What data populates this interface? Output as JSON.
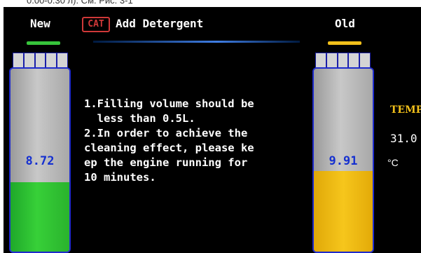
{
  "caption": "0.00-0.30 л). См. Рис. 3-1",
  "header": {
    "new_label": "New",
    "old_label": "Old",
    "badge": "CAT",
    "title": "Add Detergent"
  },
  "new_tank": {
    "value": "8.72",
    "level_fraction": 0.38,
    "color": "#37c43b"
  },
  "old_tank": {
    "value": "9.91",
    "level_fraction": 0.44,
    "color": "#f2c01a"
  },
  "instructions": {
    "text": "1.Filling volume should be\n  less than 0.5L.\n2.In order to achieve the\ncleaning effect, please ke\nep the engine running for\n10 minutes."
  },
  "temperature": {
    "label": "TEMP",
    "value": "31.0",
    "unit": "°C"
  },
  "colors": {
    "background": "#000000",
    "accent_blue": "#1f2bcc",
    "value_blue": "#1530d0",
    "badge_red": "#d03838"
  }
}
